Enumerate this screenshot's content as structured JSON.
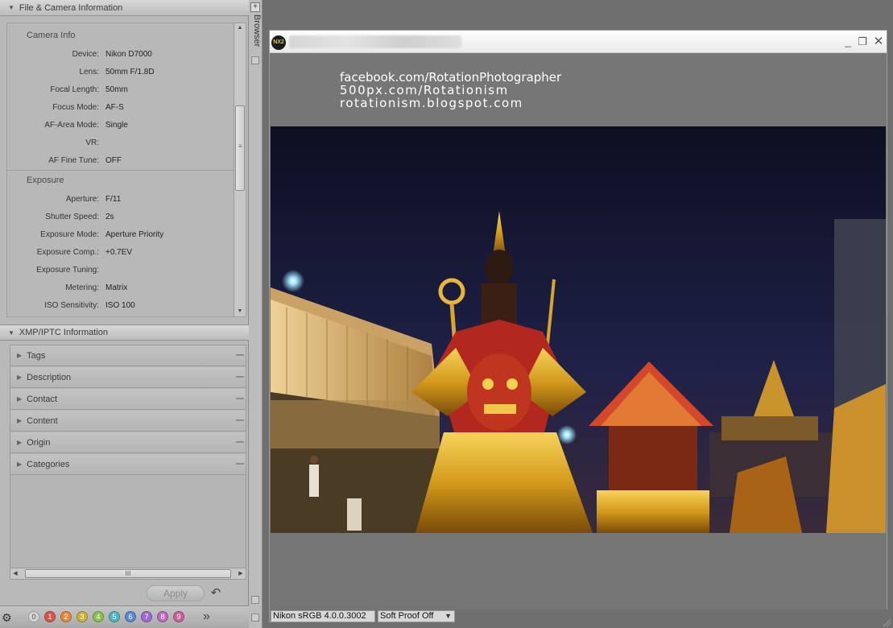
{
  "file_camera": {
    "title": "File & Camera Information",
    "camera_info": {
      "title": "Camera Info",
      "rows": [
        {
          "label": "Device:",
          "value": "Nikon D7000"
        },
        {
          "label": "Lens:",
          "value": "50mm F/1.8D"
        },
        {
          "label": "Focal Length:",
          "value": "50mm"
        },
        {
          "label": "Focus Mode:",
          "value": "AF-S"
        },
        {
          "label": "AF-Area Mode:",
          "value": "Single"
        },
        {
          "label": "VR:",
          "value": ""
        },
        {
          "label": "AF Fine Tune:",
          "value": "OFF"
        }
      ]
    },
    "exposure": {
      "title": "Exposure",
      "rows": [
        {
          "label": "Aperture:",
          "value": "F/11"
        },
        {
          "label": "Shutter Speed:",
          "value": "2s"
        },
        {
          "label": "Exposure Mode:",
          "value": "Aperture Priority"
        },
        {
          "label": "Exposure Comp.:",
          "value": "+0.7EV"
        },
        {
          "label": "Exposure Tuning:",
          "value": ""
        },
        {
          "label": "Metering:",
          "value": "Matrix"
        },
        {
          "label": "ISO Sensitivity:",
          "value": "ISO 100"
        }
      ]
    }
  },
  "xmp": {
    "title": "XMP/IPTC Information",
    "items": [
      "Tags",
      "Description",
      "Contact",
      "Content",
      "Origin",
      "Categories"
    ],
    "scroll_grip": "III"
  },
  "actions": {
    "apply_label": "Apply"
  },
  "labels": {
    "items": [
      {
        "n": "0",
        "color": "#d4d4d4"
      },
      {
        "n": "1",
        "color": "#d9534f"
      },
      {
        "n": "2",
        "color": "#e3893c"
      },
      {
        "n": "3",
        "color": "#c9b23a"
      },
      {
        "n": "4",
        "color": "#8cbf4f"
      },
      {
        "n": "5",
        "color": "#4fb3c4"
      },
      {
        "n": "6",
        "color": "#5d86d3"
      },
      {
        "n": "7",
        "color": "#9b6bd1"
      },
      {
        "n": "8",
        "color": "#c067c0"
      },
      {
        "n": "9",
        "color": "#c7619b"
      }
    ]
  },
  "side_strip": {
    "label": "Browser"
  },
  "image_window": {
    "logo_text": "NX2",
    "watermark": {
      "line1": "facebook.com/RotationPhotographer",
      "line2": "500px.com/Rotationism",
      "line3": "rotationism.blogspot.com"
    },
    "status": {
      "profile": "Nikon sRGB 4.0.0.3002",
      "soft_proof": "Soft Proof Off"
    }
  },
  "icons": {
    "collapse": "triangle-down-icon",
    "expand": "triangle-right-icon",
    "undo": "undo-icon",
    "settings": "gear-icon",
    "more": "double-chevron-right-icon",
    "minimize": "minimize-icon",
    "restore": "restore-icon",
    "close": "close-icon"
  }
}
